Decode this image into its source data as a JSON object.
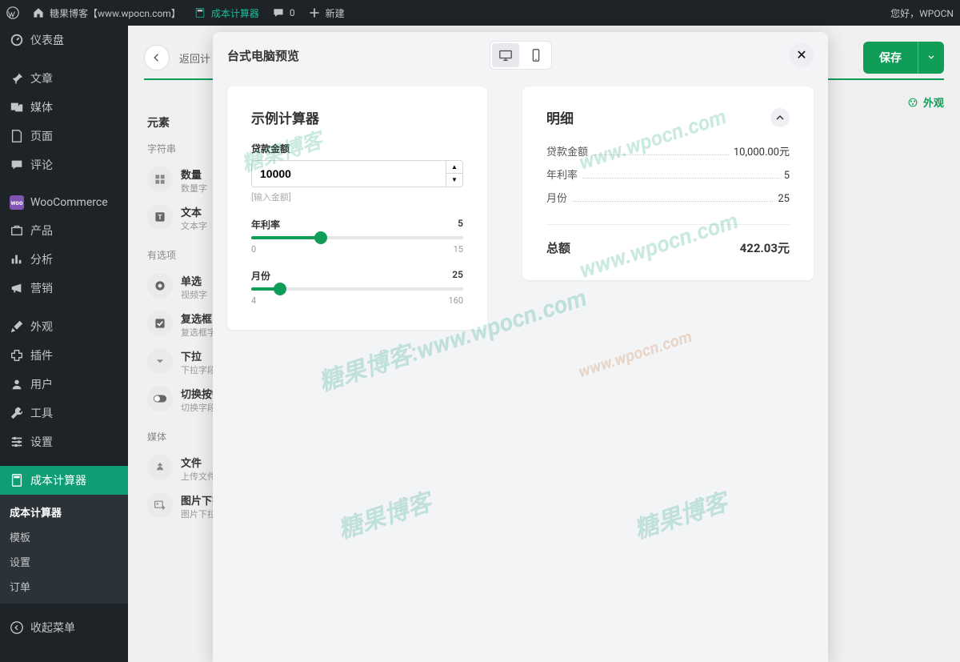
{
  "adminbar": {
    "site_name": "糖果博客【www.wpocn.com】",
    "calc_label": "成本计算器",
    "comments_count": "0",
    "new_label": "新建",
    "greeting": "您好，WPOCN"
  },
  "sidebar": {
    "items": [
      {
        "label": "仪表盘"
      },
      {
        "label": "文章"
      },
      {
        "label": "媒体"
      },
      {
        "label": "页面"
      },
      {
        "label": "评论"
      },
      {
        "label": "WooCommerce"
      },
      {
        "label": "产品"
      },
      {
        "label": "分析"
      },
      {
        "label": "营销"
      },
      {
        "label": "外观"
      },
      {
        "label": "插件"
      },
      {
        "label": "用户"
      },
      {
        "label": "工具"
      },
      {
        "label": "设置"
      },
      {
        "label": "成本计算器"
      }
    ],
    "submenu_head": "成本计算器",
    "submenu_items": [
      "模板",
      "设置",
      "订单"
    ],
    "collapse_label": "收起菜单"
  },
  "editor": {
    "back_label": "返回计",
    "save_label": "保存",
    "appearance_tab": "外观",
    "elements_heading": "元素",
    "sections": {
      "string": "字符串",
      "options": "有选项",
      "media": "媒体"
    },
    "elements": {
      "quantity": {
        "title": "数量",
        "desc": "数量字"
      },
      "text": {
        "title": "文本",
        "desc": "文本字"
      },
      "radio": {
        "title": "单选",
        "desc": "视频字"
      },
      "checkbox": {
        "title": "复选框",
        "desc": "复选框字段"
      },
      "dropdown": {
        "title": "下拉",
        "desc": "下拉字段"
      },
      "toggle": {
        "title": "切换按钮",
        "desc": "切换字段"
      },
      "file": {
        "title": "文件",
        "desc": "上传文件"
      },
      "image_dropdown": {
        "title": "图片下拉",
        "desc": "图片下拉"
      }
    }
  },
  "modal": {
    "title": "台式电脑预览",
    "calculator_title": "示例计算器",
    "loan_amount_label": "贷款金额",
    "loan_amount_value": "10000",
    "loan_amount_hint": "[输入金额]",
    "rate_label": "年利率",
    "rate_value": "5",
    "rate_min": "0",
    "rate_max": "15",
    "months_label": "月份",
    "months_value": "25",
    "months_min": "4",
    "months_max": "160",
    "detail_title": "明细",
    "detail_rows": [
      {
        "label": "贷款金额",
        "value": "10,000.00元"
      },
      {
        "label": "年利率",
        "value": "5"
      },
      {
        "label": "月份",
        "value": "25"
      }
    ],
    "total_label": "总额",
    "total_value": "422.03元"
  },
  "watermarks": [
    "糖果博客",
    "糖果博客:www.wpocn.com",
    "www.wpocn.com",
    "www.wpocn.com",
    "糖果博客",
    "糖果博客"
  ]
}
